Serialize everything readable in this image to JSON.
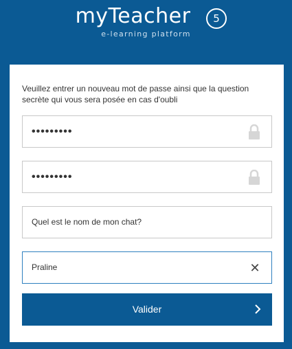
{
  "brand": {
    "name": "myTeacher",
    "version_badge": "5",
    "tagline": "e-learning platform"
  },
  "form": {
    "intro": "Veuillez entrer un nouveau mot de passe ainsi que la question secrète qui vous sera posée en cas d'oubli",
    "password": {
      "masked_value": "•••••••••",
      "icon": "lock-icon"
    },
    "password_confirm": {
      "masked_value": "•••••••••",
      "icon": "lock-icon"
    },
    "secret_question": {
      "value": "Quel est le nom de mon chat?"
    },
    "secret_answer": {
      "value": "Praline",
      "clear_icon": "✕"
    },
    "submit_label": "Valider",
    "submit_icon": "chevron-right-icon"
  },
  "colors": {
    "background": "#0b5a94",
    "card": "#ffffff",
    "button": "#0b5a94",
    "focus_border": "#2d7fbf"
  }
}
